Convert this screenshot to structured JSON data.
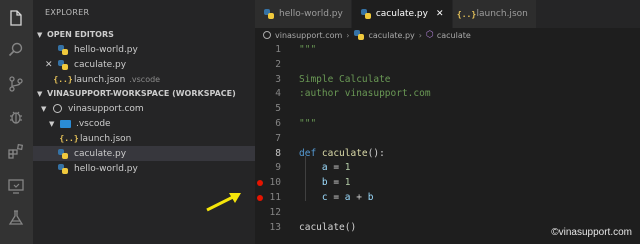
{
  "activity_bar": {
    "icons": [
      "files-icon",
      "search-icon",
      "source-control-icon",
      "debug-icon",
      "extensions-icon",
      "remote-explorer-icon",
      "flask-icon"
    ]
  },
  "sidebar": {
    "title": "EXPLORER",
    "open_editors": {
      "header": "OPEN EDITORS",
      "items": [
        {
          "label": "hello-world.py",
          "icon": "python-file-icon"
        },
        {
          "label": "caculate.py",
          "icon": "python-file-icon",
          "close": "✕"
        },
        {
          "label": "launch.json",
          "icon": "json-file-icon",
          "detail": ".vscode"
        }
      ]
    },
    "workspace": {
      "header": "VINASUPPORT-WORKSPACE (WORKSPACE)",
      "items": [
        {
          "label": "vinasupport.com",
          "icon": "folder-root-icon"
        },
        {
          "label": ".vscode",
          "icon": "vscode-folder-icon"
        },
        {
          "label": "launch.json",
          "icon": "json-file-icon"
        },
        {
          "label": "caculate.py",
          "icon": "python-file-icon"
        },
        {
          "label": "hello-world.py",
          "icon": "python-file-icon"
        }
      ]
    },
    "json_glyph": "{..}"
  },
  "tabs": [
    {
      "label": "hello-world.py",
      "icon": "python-file-icon"
    },
    {
      "label": "caculate.py",
      "icon": "python-file-icon",
      "active": true,
      "close": "✕"
    },
    {
      "label": "launch.json",
      "icon": "json-file-icon"
    }
  ],
  "breadcrumb": {
    "root": "vinasupport.com",
    "file": "caculate.py",
    "symbol": "caculate",
    "separator": "›"
  },
  "editor": {
    "lines": [
      {
        "n": "1",
        "parts": [
          {
            "t": "\"\"\"",
            "c": "c-comment"
          }
        ]
      },
      {
        "n": "2",
        "parts": []
      },
      {
        "n": "3",
        "parts": [
          {
            "t": "Simple Calculate",
            "c": "c-comment"
          }
        ]
      },
      {
        "n": "4",
        "parts": [
          {
            "t": ":author vinasupport.com",
            "c": "c-comment"
          }
        ]
      },
      {
        "n": "5",
        "parts": []
      },
      {
        "n": "6",
        "parts": [
          {
            "t": "\"\"\"",
            "c": "c-comment"
          }
        ]
      },
      {
        "n": "7",
        "parts": []
      },
      {
        "n": "8",
        "parts": [
          {
            "t": "def ",
            "c": "c-kw"
          },
          {
            "t": "caculate",
            "c": "c-fn"
          },
          {
            "t": "():",
            "c": "c-plain"
          }
        ]
      },
      {
        "n": "9",
        "parts": [
          {
            "t": "    a",
            "c": "c-var"
          },
          {
            "t": " = ",
            "c": "c-plain"
          },
          {
            "t": "1",
            "c": "c-num"
          }
        ]
      },
      {
        "n": "10",
        "parts": [
          {
            "t": "    b",
            "c": "c-var"
          },
          {
            "t": " = ",
            "c": "c-plain"
          },
          {
            "t": "1",
            "c": "c-num"
          }
        ],
        "breakpoint": true
      },
      {
        "n": "11",
        "parts": [
          {
            "t": "    c",
            "c": "c-var"
          },
          {
            "t": " = ",
            "c": "c-plain"
          },
          {
            "t": "a",
            "c": "c-var"
          },
          {
            "t": " + ",
            "c": "c-plain"
          },
          {
            "t": "b",
            "c": "c-var"
          }
        ],
        "breakpoint": true
      },
      {
        "n": "12",
        "parts": []
      },
      {
        "n": "13",
        "parts": [
          {
            "t": "caculate",
            "c": "c-plain"
          },
          {
            "t": "()",
            "c": "c-plain"
          }
        ]
      }
    ],
    "current_line": "8"
  },
  "watermark": "©vinasupport.com",
  "colors": {
    "breakpoint": "#e51400",
    "arrow": "#f5e50a",
    "activity_bar": "#333333",
    "sidebar": "#252526",
    "editor": "#1e1e1e"
  }
}
